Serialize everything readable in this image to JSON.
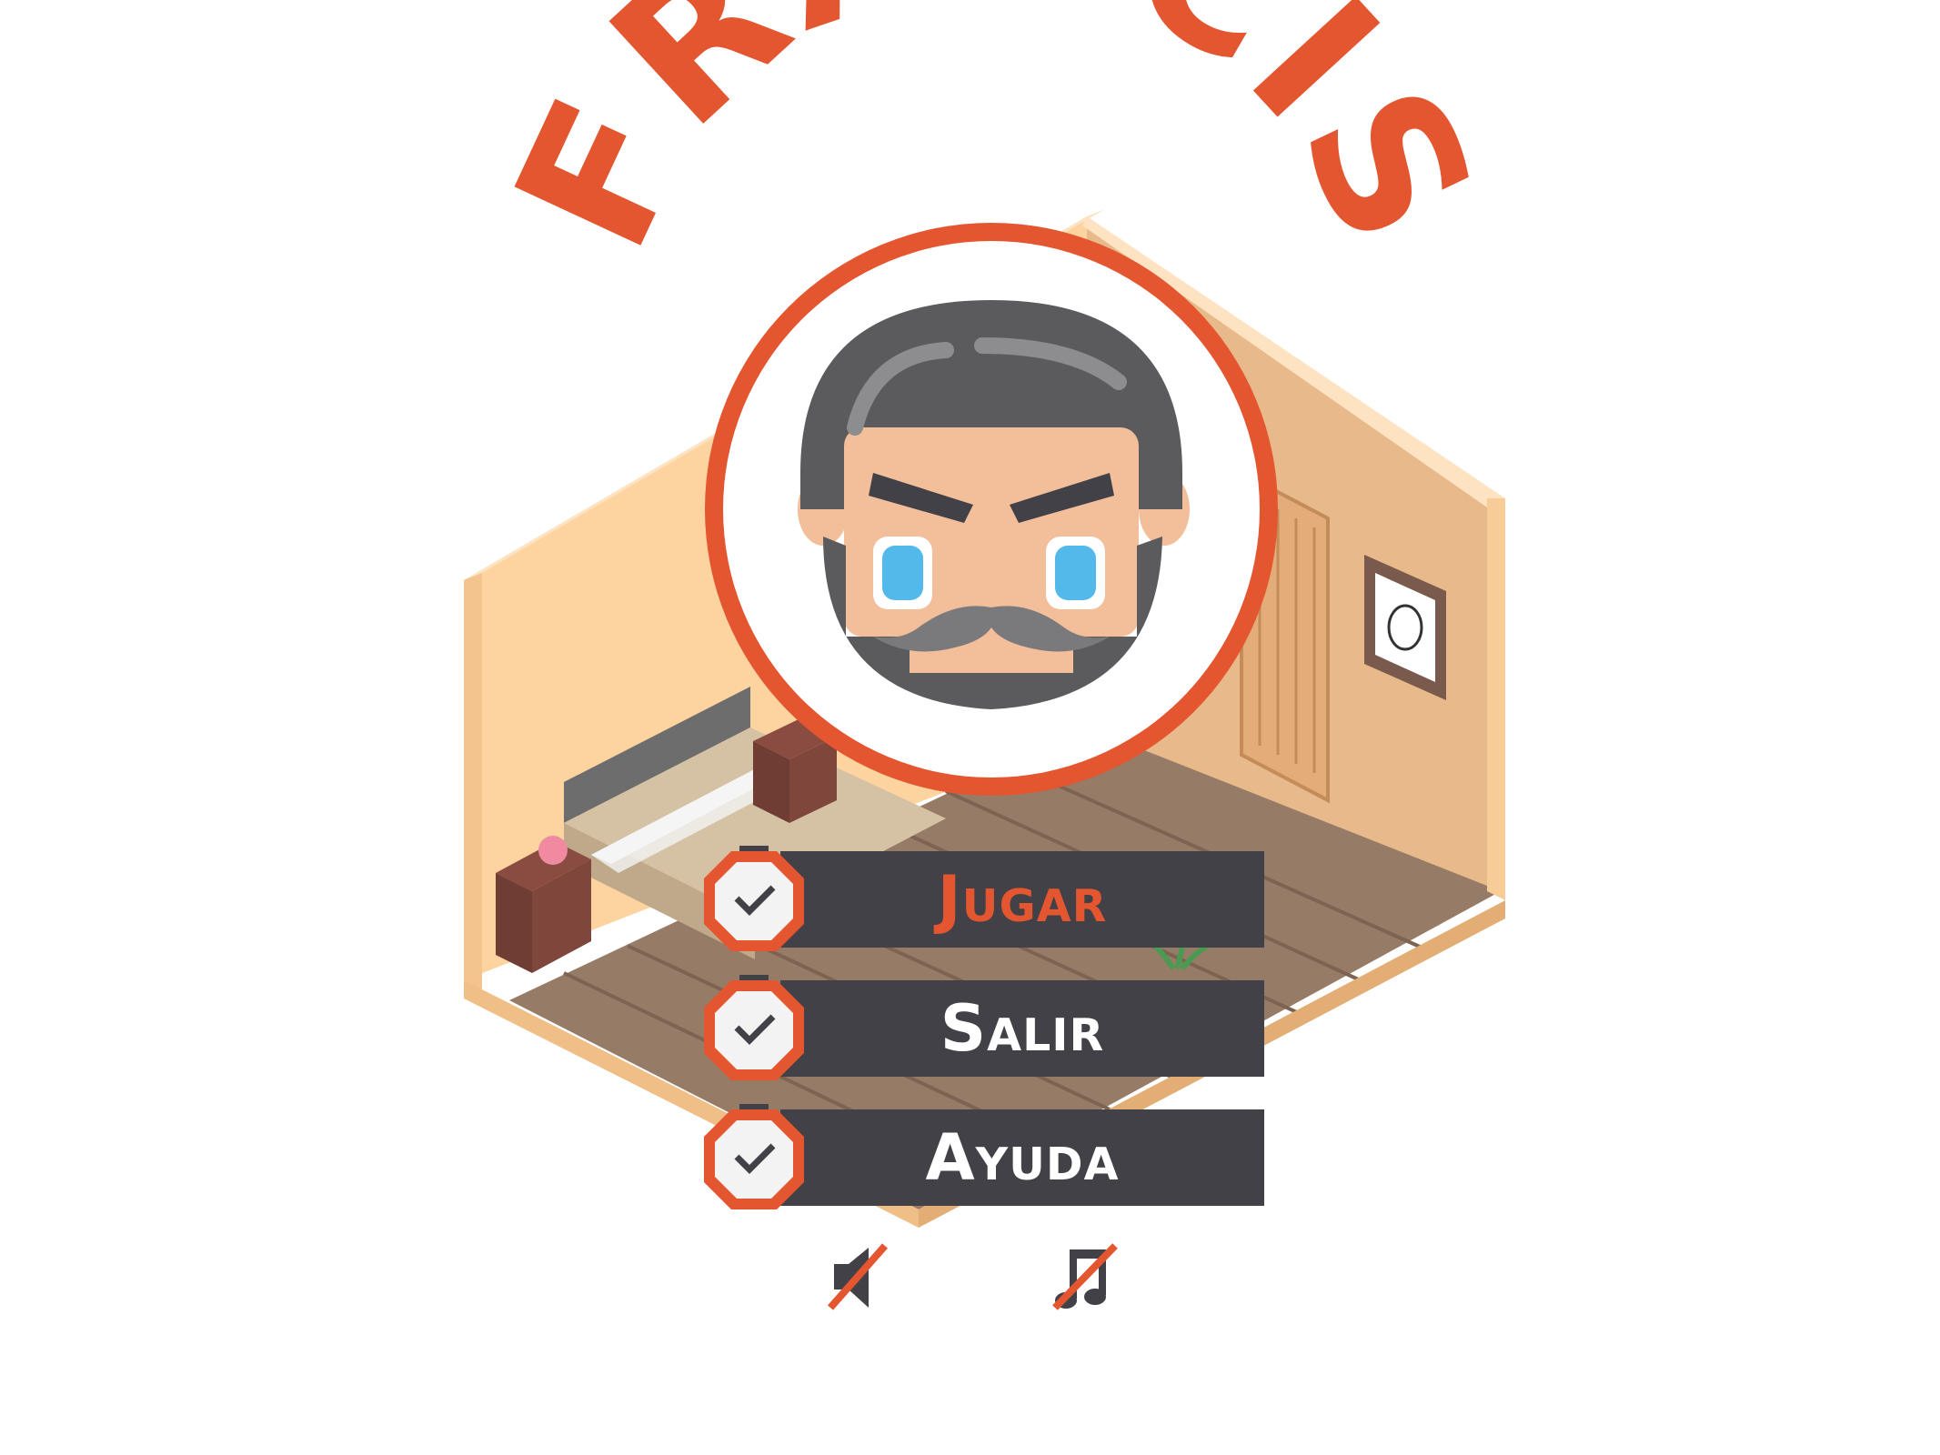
{
  "game": {
    "title": "FRANCIS"
  },
  "menu": {
    "items": [
      {
        "label": "Jugar",
        "state": "selected",
        "color": "#e3562f"
      },
      {
        "label": "Salir",
        "state": "normal",
        "color": "#ffffff"
      },
      {
        "label": "Ayuda",
        "state": "normal",
        "color": "#ffffff"
      }
    ],
    "icon": "checkmark-icon"
  },
  "audio_toggles": [
    {
      "name": "sound",
      "icon": "speaker-muted-icon",
      "muted": true
    },
    {
      "name": "music",
      "icon": "music-note-muted-icon",
      "muted": true
    }
  ],
  "colors": {
    "accent": "#e3562f",
    "bar": "#414147",
    "hair": "#5b5b5d",
    "skin": "#f3be9a",
    "eye": "#52b9ea",
    "wall": "#fdd3a0",
    "floor": "#967b66"
  }
}
